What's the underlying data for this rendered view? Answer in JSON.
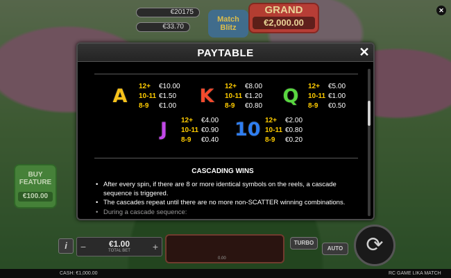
{
  "background": {
    "balance_1": "€20175",
    "balance_2": "€33.70",
    "balance_3": "",
    "logo_text": "Match Blitz",
    "grand_label": "GRAND",
    "grand_value": "€2,000.00",
    "buy_feature_line1": "BUY",
    "buy_feature_line2": "FEATURE",
    "buy_feature_price": "€100.00",
    "bet_value": "€1.00",
    "bet_label": "TOTAL BET",
    "spin_area_num": "0.00",
    "turbo_label": "TURBO",
    "auto_label": "AUTO",
    "cash_text": "CASH: €1,000.00",
    "game_name": "RC GAME LIKA MATCH",
    "close_icon": "close-icon",
    "spin_icon": "spin-arrows-icon",
    "info_icon": "info-icon"
  },
  "modal": {
    "title": "PAYTABLE",
    "close_icon": "close-icon",
    "symbols": [
      {
        "glyph": "A",
        "color": "#f7c21a",
        "pays": [
          {
            "count": "12+",
            "amount": "€10.00"
          },
          {
            "count": "10-11",
            "amount": "€1.50"
          },
          {
            "count": "8-9",
            "amount": "€1.00"
          }
        ]
      },
      {
        "glyph": "K",
        "color": "#f24a2d",
        "pays": [
          {
            "count": "12+",
            "amount": "€8.00"
          },
          {
            "count": "10-11",
            "amount": "€1.20"
          },
          {
            "count": "8-9",
            "amount": "€0.80"
          }
        ]
      },
      {
        "glyph": "Q",
        "color": "#59d640",
        "pays": [
          {
            "count": "12+",
            "amount": "€5.00"
          },
          {
            "count": "10-11",
            "amount": "€1.00"
          },
          {
            "count": "8-9",
            "amount": "€0.50"
          }
        ]
      },
      {
        "glyph": "J",
        "color": "#c248e8",
        "pays": [
          {
            "count": "12+",
            "amount": "€4.00"
          },
          {
            "count": "10-11",
            "amount": "€0.90"
          },
          {
            "count": "8-9",
            "amount": "€0.40"
          }
        ]
      },
      {
        "glyph": "10",
        "color": "#2f7ef0",
        "pays": [
          {
            "count": "12+",
            "amount": "€2.00"
          },
          {
            "count": "10-11",
            "amount": "€0.80"
          },
          {
            "count": "8-9",
            "amount": "€0.20"
          }
        ]
      }
    ],
    "section_title": "CASCADING WINS",
    "bullets": [
      "After every spin, if there are 8 or more identical symbols on the reels, a cascade sequence is triggered.",
      "The cascades repeat until there are no more non-SCATTER winning combinations.",
      "During a cascade sequence:"
    ]
  }
}
